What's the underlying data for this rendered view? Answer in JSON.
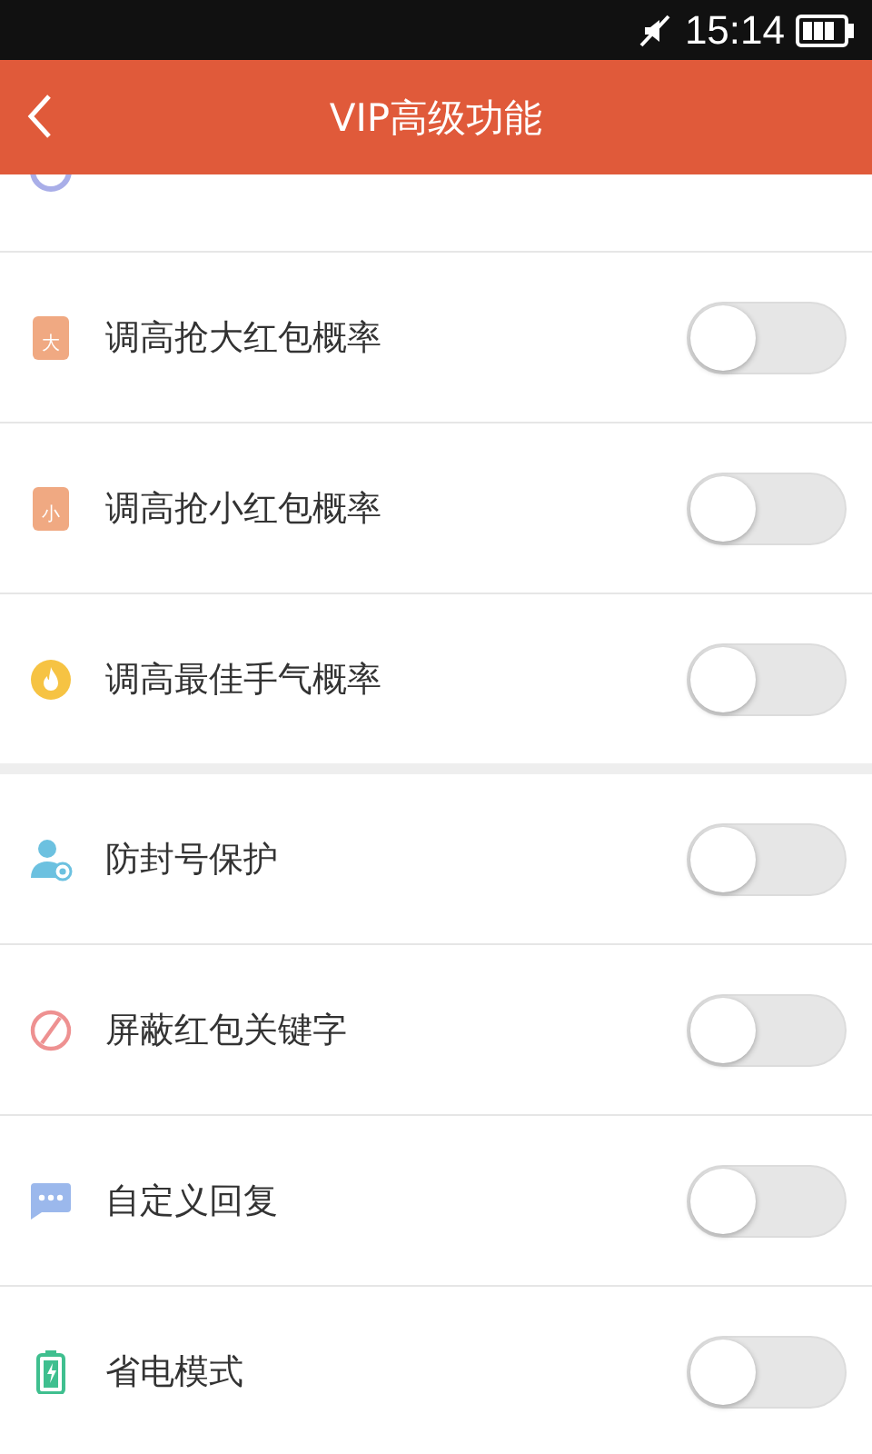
{
  "status_bar": {
    "time": "15:14"
  },
  "header": {
    "title": "VIP高级功能"
  },
  "sections": [
    {
      "items": [
        {
          "kind": "envelope",
          "icon_text": "大",
          "label": "调高抢大红包概率",
          "on": false
        },
        {
          "kind": "envelope",
          "icon_text": "小",
          "label": "调高抢小红包概率",
          "on": false
        },
        {
          "kind": "flame",
          "label": "调高最佳手气概率",
          "on": false
        }
      ]
    },
    {
      "items": [
        {
          "kind": "user",
          "label": "防封号保护",
          "on": false
        },
        {
          "kind": "forbidden",
          "label": "屏蔽红包关键字",
          "on": false
        },
        {
          "kind": "chat",
          "label": "自定义回复",
          "on": false
        },
        {
          "kind": "battery",
          "label": "省电模式",
          "on": false
        }
      ]
    }
  ]
}
